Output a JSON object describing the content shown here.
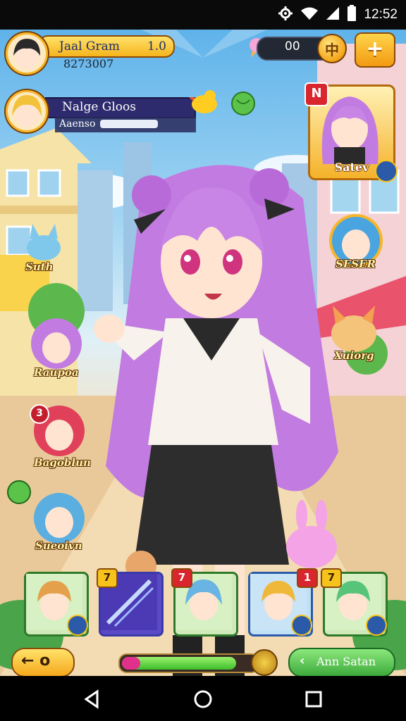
{
  "status_bar": {
    "time": "12:52"
  },
  "player": {
    "name": "Jaal Gram",
    "level": "1.0",
    "id": "8273007"
  },
  "currency": {
    "amount": "00",
    "coin_symbol": "中",
    "add_symbol": "+"
  },
  "guild": {
    "name": "Nalge Gloos",
    "sub_label": "Aaenso"
  },
  "featured_hero": {
    "badge": "N",
    "label": "Satev"
  },
  "left_roster": [
    {
      "label": "Suth"
    },
    {
      "label": "Raupoa"
    },
    {
      "label": "Bagoblun",
      "badge": "3"
    },
    {
      "label": "Sueoivn"
    }
  ],
  "right_roster": [
    {
      "label": "SESER"
    },
    {
      "label": "Xuiorg"
    }
  ],
  "hero_slots": [
    {
      "badge": "",
      "color": "#8fd14f"
    },
    {
      "badge": "7",
      "color": "#6a4cc7"
    },
    {
      "badge": "7",
      "color": "#7bd060"
    },
    {
      "badge": "1",
      "color": "#6aa0e0"
    },
    {
      "badge": "7",
      "color": "#7bd060"
    }
  ],
  "back_button": {
    "label": "← o"
  },
  "progress": {
    "value": 0.85
  },
  "action_button": {
    "label": "Ann Satan",
    "chevron": "‹"
  },
  "colors": {
    "accent_gold": "#f5b41c",
    "hero_hair": "#c27be0"
  }
}
